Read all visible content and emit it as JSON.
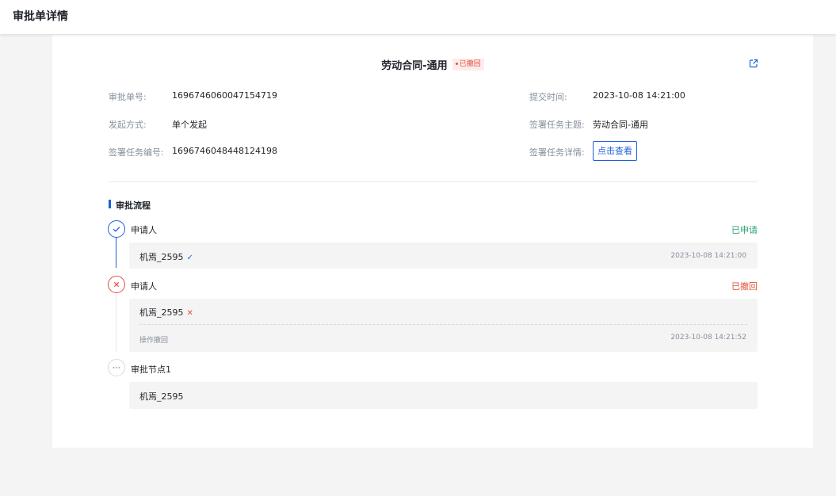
{
  "page": {
    "title": "审批单详情"
  },
  "document": {
    "title": "劳动合同-通用",
    "status_badge": "已撤回",
    "status_color": "#e2513c",
    "external_link_icon": "external-link-icon"
  },
  "info": {
    "approval_no": {
      "label": "审批单号:",
      "value": "1696746060047154719"
    },
    "submit_time": {
      "label": "提交时间:",
      "value": "2023-10-08 14:21:00"
    },
    "launch_mode": {
      "label": "发起方式:",
      "value": "单个发起"
    },
    "task_subject": {
      "label": "签署任务主题:",
      "value": "劳动合同-通用"
    },
    "task_no": {
      "label": "签署任务编号:",
      "value": "1696746048448124198"
    },
    "task_detail": {
      "label": "签署任务详情:",
      "button": "点击查看"
    }
  },
  "flow": {
    "title": "审批流程",
    "accent_color": "#1f5fd8",
    "nodes": [
      {
        "name": "申请人",
        "status": "已申请",
        "status_color": "#2ba471",
        "icon": "check-icon",
        "person": "机焉_2595",
        "person_icon": "check-icon",
        "time": "2023-10-08 14:21:00"
      },
      {
        "name": "申请人",
        "status": "已撤回",
        "status_color": "#e2513c",
        "icon": "close-icon",
        "person": "机焉_2595",
        "person_icon": "close-icon",
        "note": "操作撤回",
        "time": "2023-10-08 14:21:52"
      },
      {
        "name": "审批节点1",
        "status": "",
        "icon": "more-icon",
        "person": "机焉_2595"
      }
    ]
  }
}
